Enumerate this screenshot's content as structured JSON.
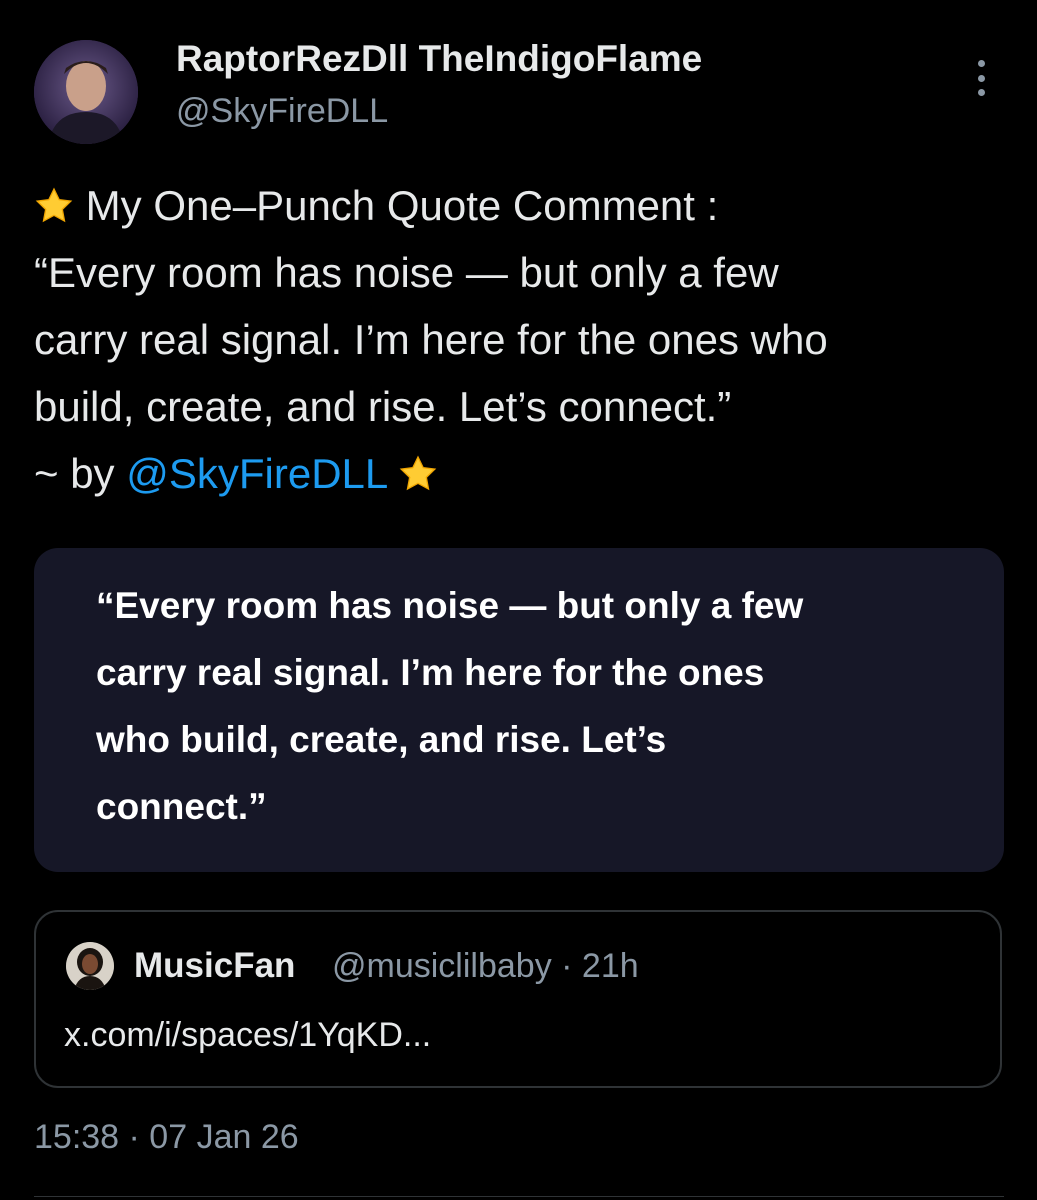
{
  "author": {
    "display_name": "RaptorRezDll TheIndigoFlame",
    "handle": "@SkyFireDLL"
  },
  "tweet": {
    "line1_text": "My One–Punch Quote Comment :",
    "line2": "“Every room has noise — but only a few",
    "line3": "carry real signal. I’m here for the ones who",
    "line4": "build, create, and rise. Let’s connect.”",
    "line5_prefix": "~ by ",
    "line5_mention": "@SkyFireDLL"
  },
  "media_card": {
    "lines": [
      "“Every room has noise — but only a few",
      "carry real signal. I’m here for the ones",
      "who build, create, and rise. Let’s",
      "connect.”"
    ]
  },
  "quoted_post": {
    "name": "MusicFan",
    "handle": "@musiclilbaby",
    "time": "· 21h",
    "link": "x.com/i/spaces/1YqKD..."
  },
  "timestamp": "15:38 · 07 Jan 26",
  "icons": {
    "star": "star-emoji",
    "more": "more-vertical-icon"
  },
  "colors": {
    "mention": "#1d9bf0",
    "secondary_text": "#8b98a5",
    "background": "#000000"
  }
}
